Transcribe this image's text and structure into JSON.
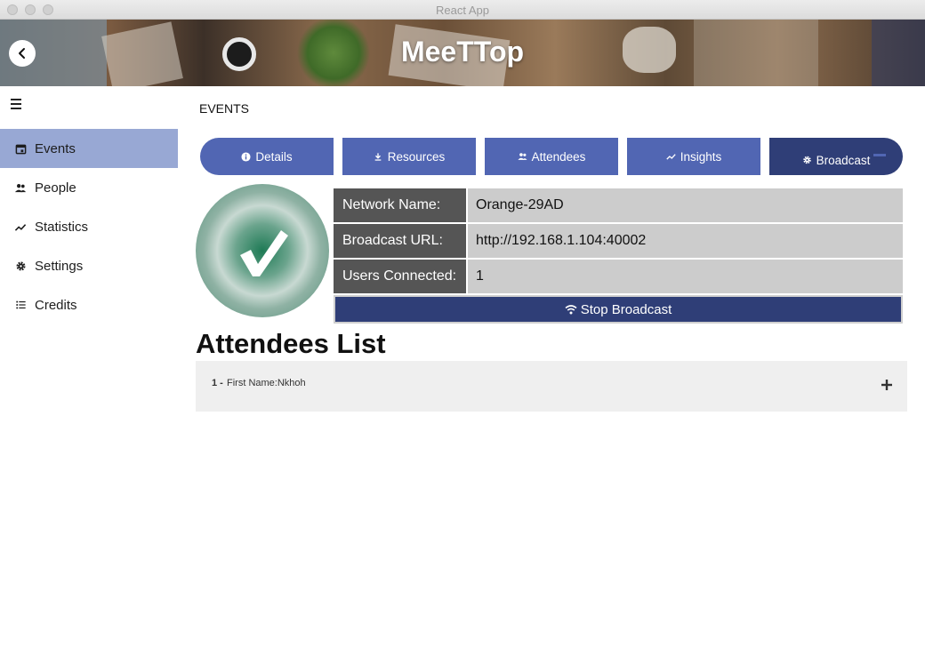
{
  "window": {
    "title": "React App"
  },
  "header": {
    "app_name": "MeeTTop",
    "back_icon": "chevron-left-icon"
  },
  "sidebar": {
    "menu_icon": "hamburger-icon",
    "items": [
      {
        "label": "Events",
        "icon": "calendar-icon",
        "active": true
      },
      {
        "label": "People",
        "icon": "people-icon",
        "active": false
      },
      {
        "label": "Statistics",
        "icon": "trending-up-icon",
        "active": false
      },
      {
        "label": "Settings",
        "icon": "gear-icon",
        "active": false
      },
      {
        "label": "Credits",
        "icon": "list-icon",
        "active": false
      }
    ]
  },
  "main": {
    "title": "EVENTS",
    "tabs": [
      {
        "label": "Details",
        "icon": "info-icon"
      },
      {
        "label": "Resources",
        "icon": "download-icon"
      },
      {
        "label": "Attendees",
        "icon": "people-icon"
      },
      {
        "label": "Insights",
        "icon": "trending-up-icon"
      },
      {
        "label": "Broadcast",
        "icon": "gear-icon",
        "active": true
      }
    ],
    "status_icon": "checkmark-icon",
    "info": [
      {
        "key": "Network Name:",
        "value": "Orange-29AD"
      },
      {
        "key": "Broadcast URL:",
        "value": "http://192.168.1.104:40002"
      },
      {
        "key": "Users Connected:",
        "value": "1"
      }
    ],
    "stop_button": {
      "label": "Stop Broadcast",
      "icon": "wifi-icon"
    },
    "attendees": {
      "title": "Attendees List",
      "items": [
        {
          "number": "1 -",
          "name": "First Name:Nkhoh",
          "expand_icon": "plus-icon"
        }
      ]
    }
  },
  "colors": {
    "primary": "#5166b3",
    "active_tab": "#2f3e77",
    "sidebar_active": "#98a8d4",
    "table_key": "#555555",
    "table_value": "#cccccc"
  }
}
